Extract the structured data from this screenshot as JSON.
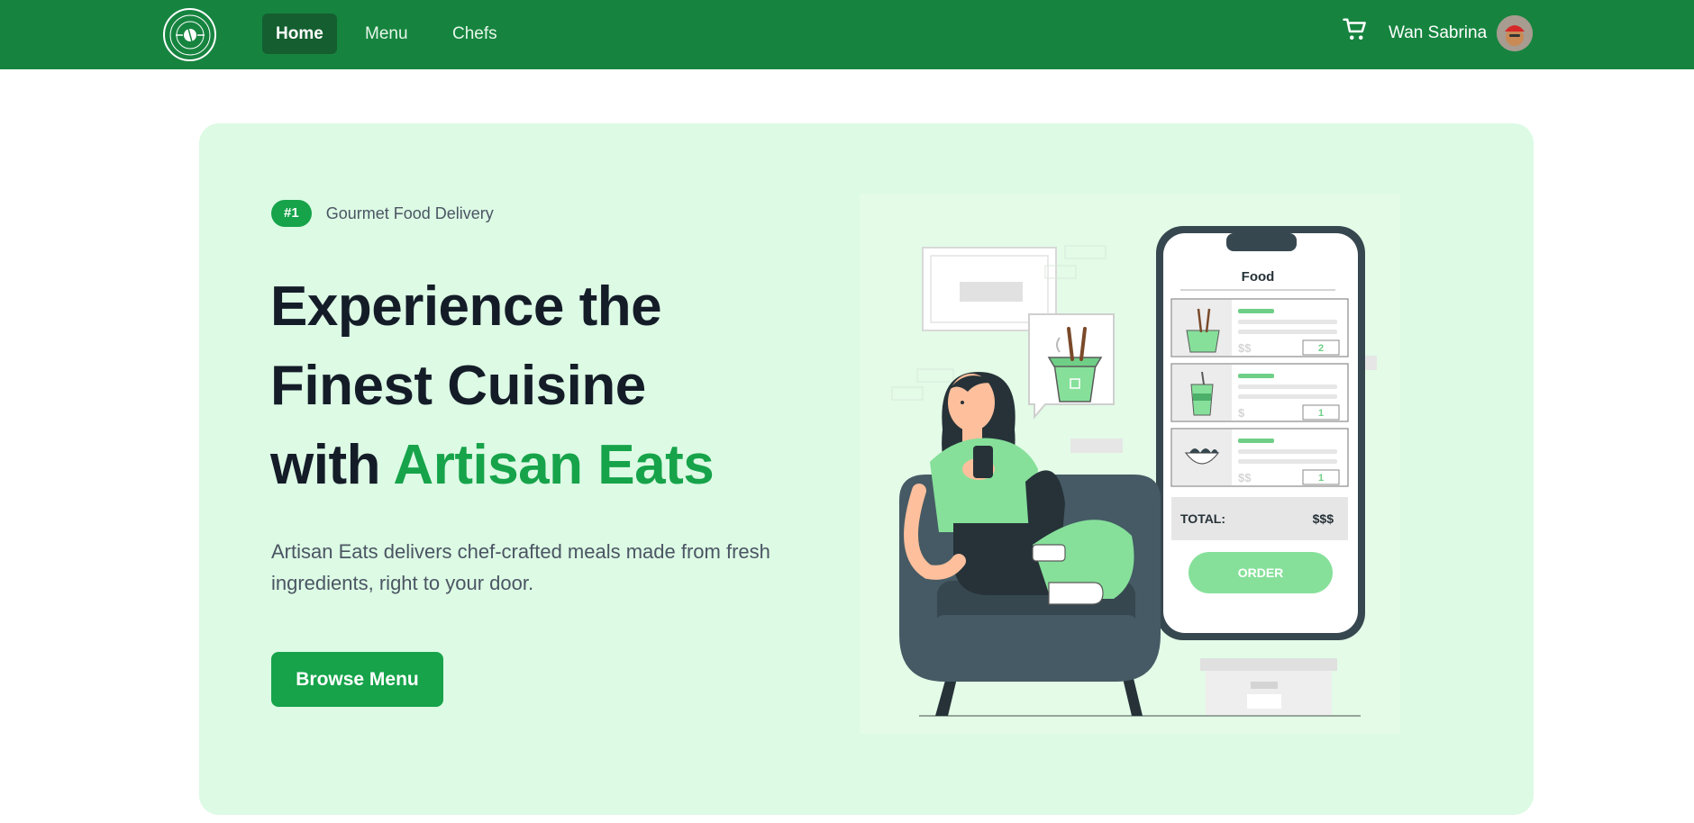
{
  "nav": {
    "links": [
      {
        "label": "Home",
        "active": true
      },
      {
        "label": "Menu",
        "active": false
      },
      {
        "label": "Chefs",
        "active": false
      }
    ],
    "user_name": "Wan Sabrina",
    "cart_icon": "cart-icon"
  },
  "hero": {
    "badge": "#1",
    "badge_text": "Gourmet Food Delivery",
    "headline_line1": "Experience the",
    "headline_line2": "Finest Cuisine",
    "headline_line3_prefix": "with",
    "headline_accent": "Artisan Eats",
    "subtext": "Artisan Eats delivers chef-crafted meals made from fresh ingredients, right to your door.",
    "cta_label": "Browse Menu"
  },
  "illustration": {
    "phone_title": "Food",
    "items": [
      {
        "price": "$$",
        "qty": "2"
      },
      {
        "price": "$",
        "qty": "1"
      },
      {
        "price": "$$",
        "qty": "1"
      }
    ],
    "total_label": "TOTAL:",
    "total_value": "$$$",
    "order_label": "ORDER"
  },
  "colors": {
    "nav_bg": "#16843f",
    "accent": "#16a34a",
    "hero_bg": "#dcfae4",
    "heading": "#141c28"
  }
}
